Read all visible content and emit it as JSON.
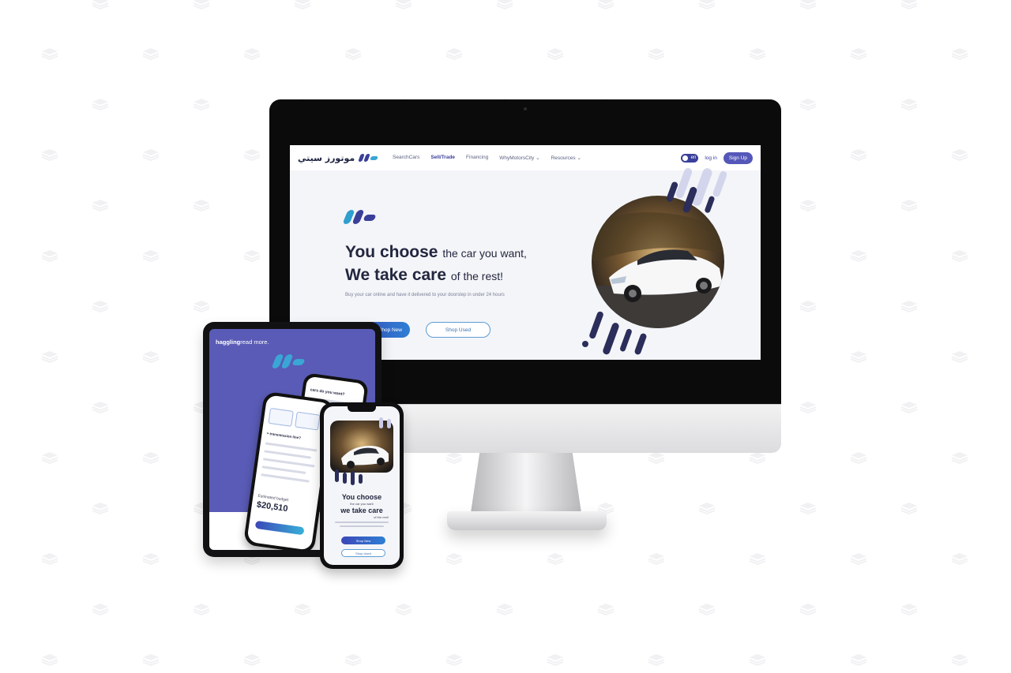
{
  "colors": {
    "brand_indigo": "#3a3f9a",
    "brand_purple": "#5a5bb6",
    "brand_cyan": "#3aa6d6",
    "text_dark": "#22263f"
  },
  "desktop": {
    "brand_name_ar": "موتورز سيتي",
    "nav": {
      "links": [
        {
          "label": "SearchCars",
          "active": false
        },
        {
          "label": "Sell/Trade",
          "active": true
        },
        {
          "label": "Financing",
          "active": false
        },
        {
          "label": "WhyMotorsCity",
          "active": false,
          "icon": "chevron-down-icon"
        },
        {
          "label": "Resources",
          "active": false,
          "icon": "chevron-down-icon"
        }
      ],
      "toggle_label": "en",
      "login_label": "log in",
      "signup_label": "Sign Up"
    },
    "hero": {
      "line1_bold": "You choose",
      "line1_rest": "the car you want,",
      "line2_bold": "We take care",
      "line2_rest": "of the rest!",
      "subtitle": "Buy your car online and have it delivered to your doorstep in under 24 hours",
      "primary_button": "Shop New",
      "secondary_button": "Shop Used"
    }
  },
  "tablet": {
    "text_bold": "haggling",
    "text_rest": "read more.",
    "inner_question": "cars do you want?",
    "inner_question_2": "> transmission line?",
    "price_label": "Estimated budget",
    "price": "$20,510"
  },
  "phone": {
    "line1_bold": "You choose",
    "line1_rest": "the car you want",
    "line2_bold": "we take care",
    "line2_rest": "of the rest!",
    "primary_button": "Shop New",
    "secondary_button": "Shop Used"
  }
}
